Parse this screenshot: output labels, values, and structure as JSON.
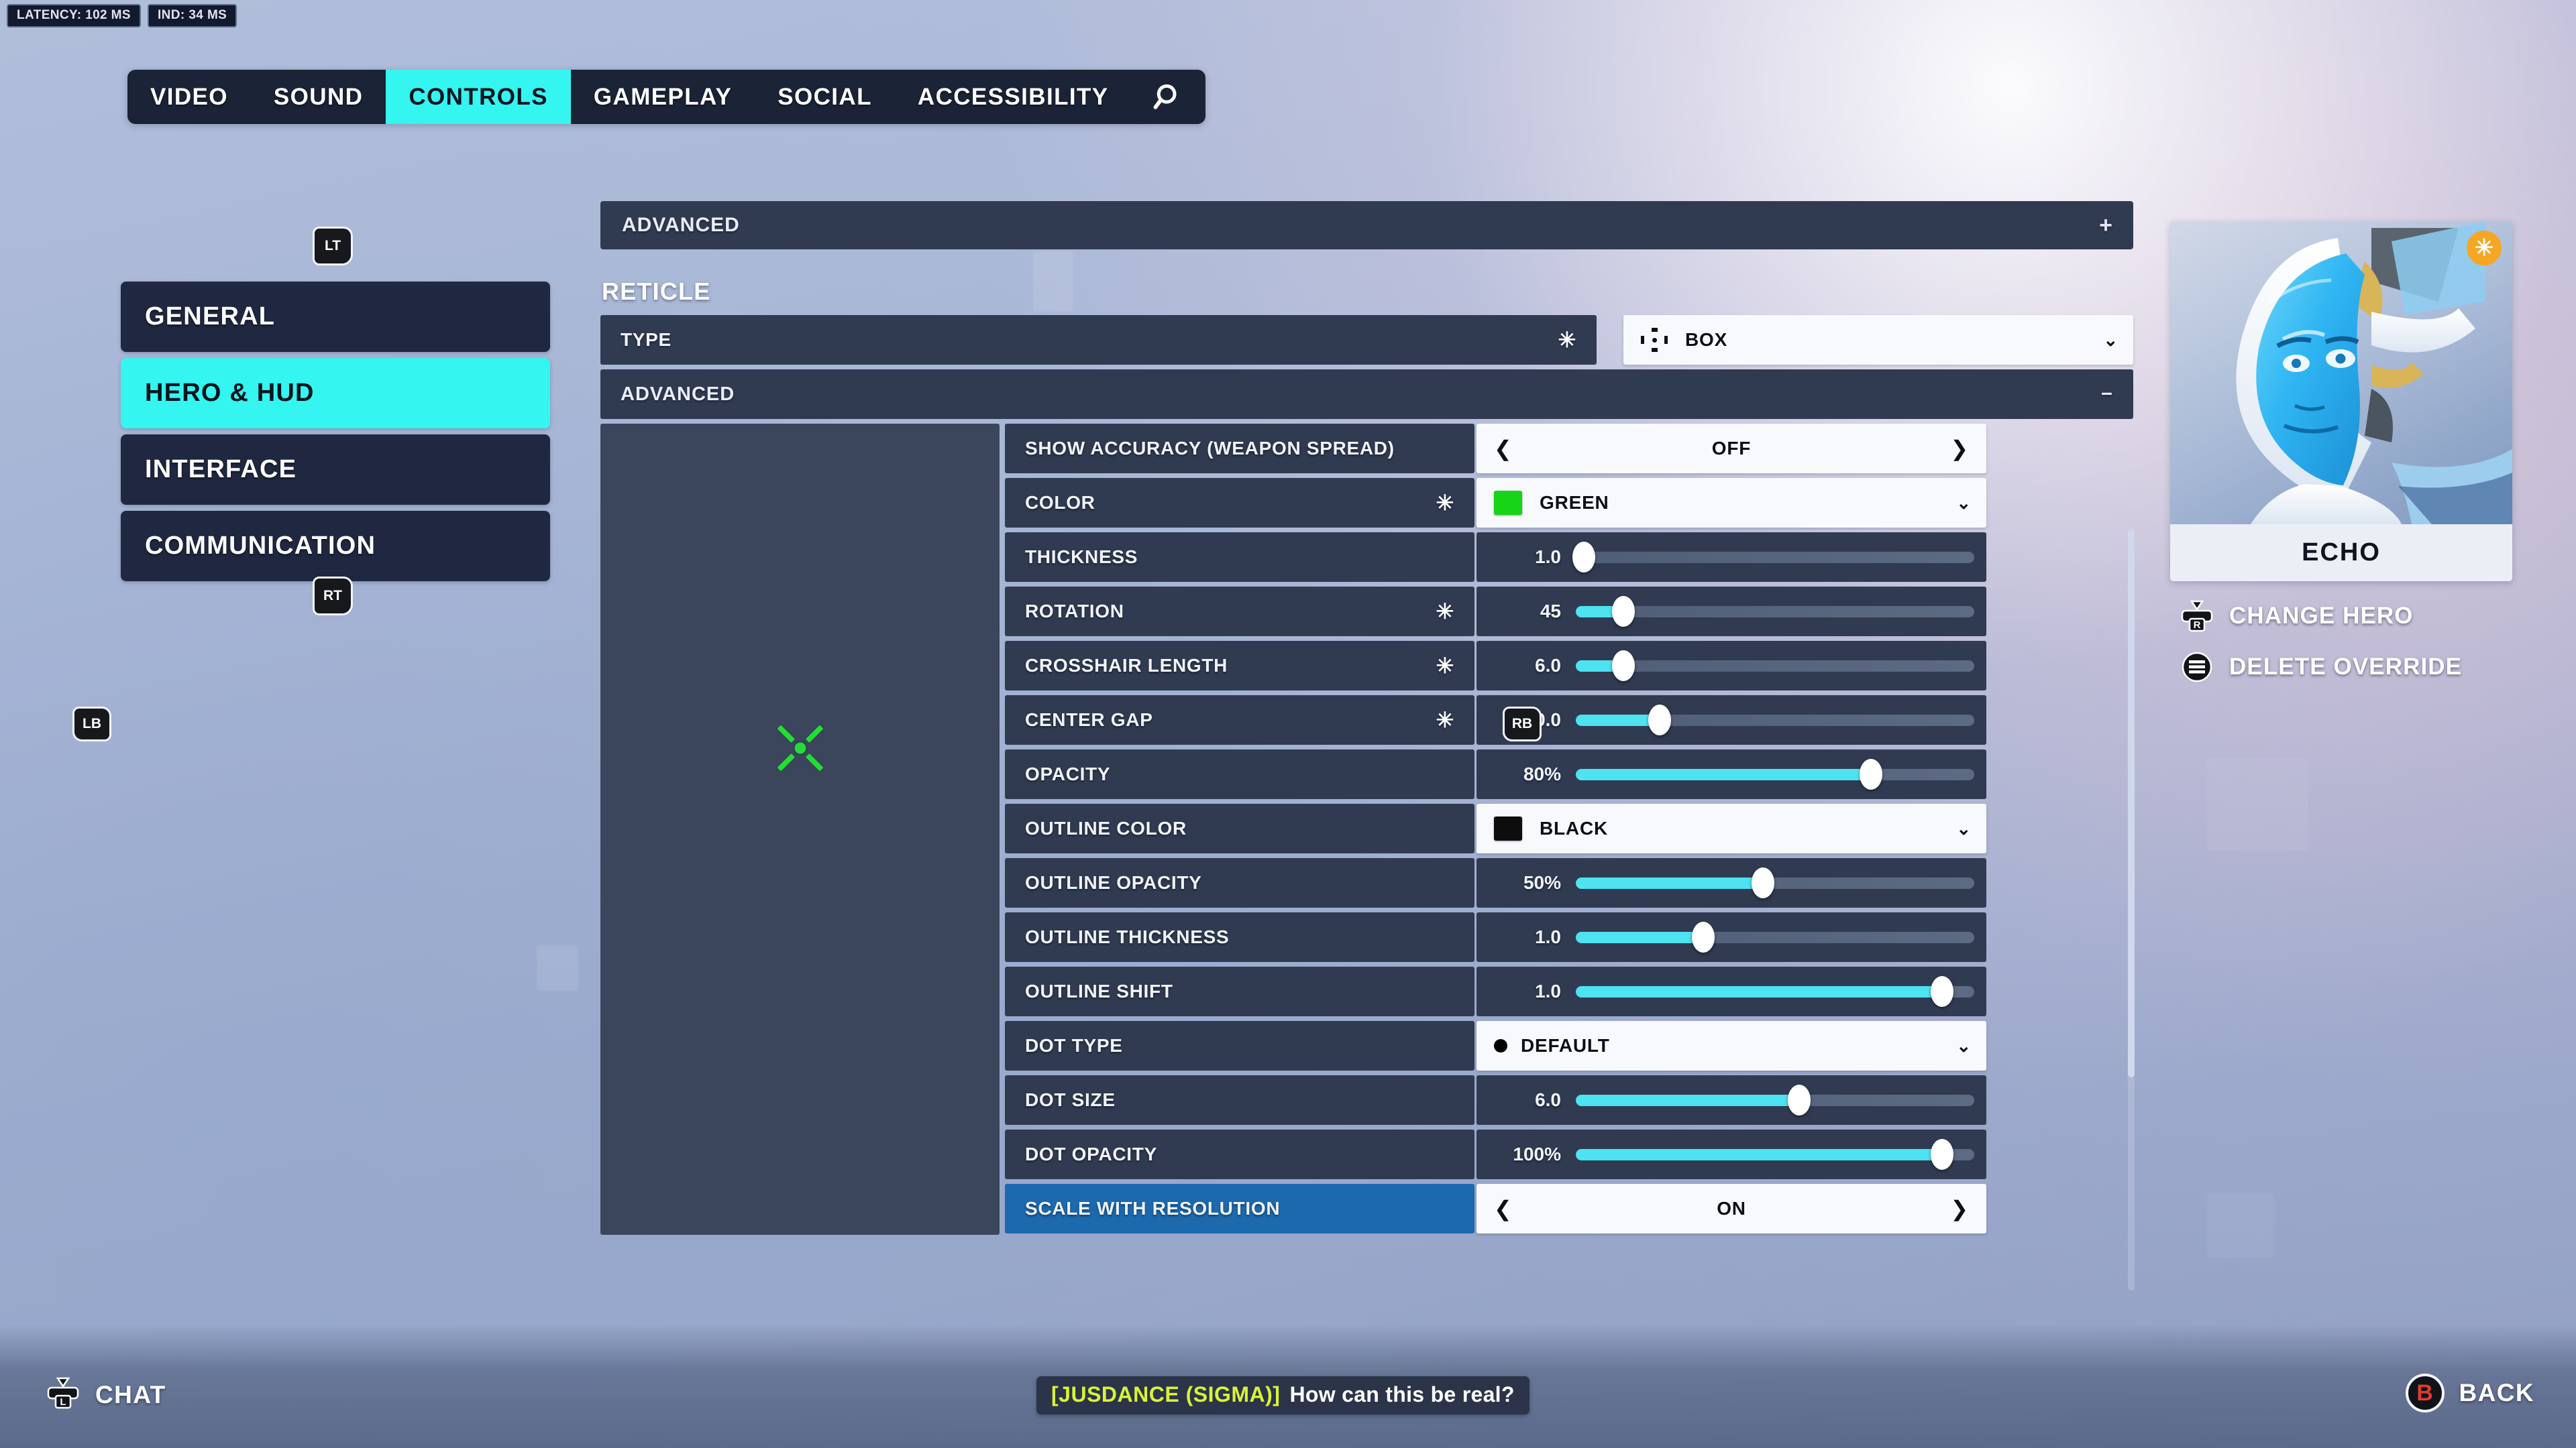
{
  "hud": {
    "latency_label": "LATENCY: 102 MS",
    "ind_label": "IND:  34 MS"
  },
  "topnav": {
    "left_bumper": "LB",
    "right_bumper": "RB",
    "search_icon": "search-icon",
    "tabs": [
      {
        "label": "VIDEO",
        "active": false
      },
      {
        "label": "SOUND",
        "active": false
      },
      {
        "label": "CONTROLS",
        "active": true
      },
      {
        "label": "GAMEPLAY",
        "active": false
      },
      {
        "label": "SOCIAL",
        "active": false
      },
      {
        "label": "ACCESSIBILITY",
        "active": false
      }
    ]
  },
  "sidebar": {
    "left_trigger": "LT",
    "right_trigger": "RT",
    "items": [
      {
        "label": "GENERAL",
        "active": false
      },
      {
        "label": "HERO & HUD",
        "active": true
      },
      {
        "label": "INTERFACE",
        "active": false
      },
      {
        "label": "COMMUNICATION",
        "active": false
      }
    ]
  },
  "main": {
    "advanced_top": {
      "label": "ADVANCED",
      "toggle_glyph": "+"
    },
    "section_title": "RETICLE",
    "type_row": {
      "label": "TYPE",
      "override_marker": "✳",
      "value": "BOX",
      "chevron": "⌄"
    },
    "advanced_sub": {
      "label": "ADVANCED",
      "toggle_glyph": "−"
    },
    "rows": [
      {
        "label": "SHOW ACCURACY (WEAPON SPREAD)",
        "marker": "",
        "control": "stepper",
        "value": "OFF",
        "left_arrow": "❮",
        "right_arrow": "❯",
        "selected": false
      },
      {
        "label": "COLOR",
        "marker": "✳",
        "control": "select",
        "value": "GREEN",
        "swatch": "#17d417",
        "chevron": "⌄",
        "selected": false
      },
      {
        "label": "THICKNESS",
        "marker": "",
        "control": "slider",
        "value": "1.0",
        "pct": 2,
        "selected": false
      },
      {
        "label": "ROTATION",
        "marker": "✳",
        "control": "slider",
        "value": "45",
        "pct": 12,
        "selected": false
      },
      {
        "label": "CROSSHAIR LENGTH",
        "marker": "✳",
        "control": "slider",
        "value": "6.0",
        "pct": 12,
        "selected": false
      },
      {
        "label": "CENTER GAP",
        "marker": "✳",
        "control": "slider",
        "value": "20.0",
        "pct": 21,
        "selected": false
      },
      {
        "label": "OPACITY",
        "marker": "",
        "control": "slider",
        "value": "80%",
        "pct": 74,
        "selected": false
      },
      {
        "label": "OUTLINE COLOR",
        "marker": "",
        "control": "select",
        "value": "BLACK",
        "swatch": "#0d0d0d",
        "chevron": "⌄",
        "selected": false
      },
      {
        "label": "OUTLINE OPACITY",
        "marker": "",
        "control": "slider",
        "value": "50%",
        "pct": 47,
        "selected": false
      },
      {
        "label": "OUTLINE THICKNESS",
        "marker": "",
        "control": "slider",
        "value": "1.0",
        "pct": 32,
        "selected": false
      },
      {
        "label": "OUTLINE SHIFT",
        "marker": "",
        "control": "slider",
        "value": "1.0",
        "pct": 92,
        "selected": false
      },
      {
        "label": "DOT TYPE",
        "marker": "",
        "control": "select",
        "value": "DEFAULT",
        "dot": true,
        "chevron": "⌄",
        "selected": false
      },
      {
        "label": "DOT SIZE",
        "marker": "",
        "control": "slider",
        "value": "6.0",
        "pct": 56,
        "selected": false
      },
      {
        "label": "DOT OPACITY",
        "marker": "",
        "control": "slider",
        "value": "100%",
        "pct": 92,
        "selected": false
      },
      {
        "label": "SCALE WITH RESOLUTION",
        "marker": "",
        "control": "stepper",
        "value": "ON",
        "left_arrow": "❮",
        "right_arrow": "❯",
        "selected": true
      }
    ]
  },
  "preview": {
    "crosshair_color": "#22dd33",
    "rotation_deg": 45
  },
  "hero_panel": {
    "name": "ECHO",
    "badge_glyph": "✳",
    "actions": [
      {
        "label": "CHANGE HERO",
        "glyph": "R",
        "icon": "right-stick-icon"
      },
      {
        "label": "DELETE OVERRIDE",
        "glyph": "≡",
        "icon": "menu-button-icon"
      }
    ]
  },
  "bottom": {
    "chat": {
      "glyph": "L",
      "label": "CHAT"
    },
    "back": {
      "glyph": "B",
      "label": "BACK"
    },
    "chat_message": {
      "author": "[JUSDANCE (SIGMA)]",
      "text": "How can this be real?"
    }
  },
  "colors": {
    "accent_cyan": "#34f5f0",
    "slider_fill": "#4de3f0",
    "selected_row": "#1d69ae",
    "panel": "#303b52"
  }
}
